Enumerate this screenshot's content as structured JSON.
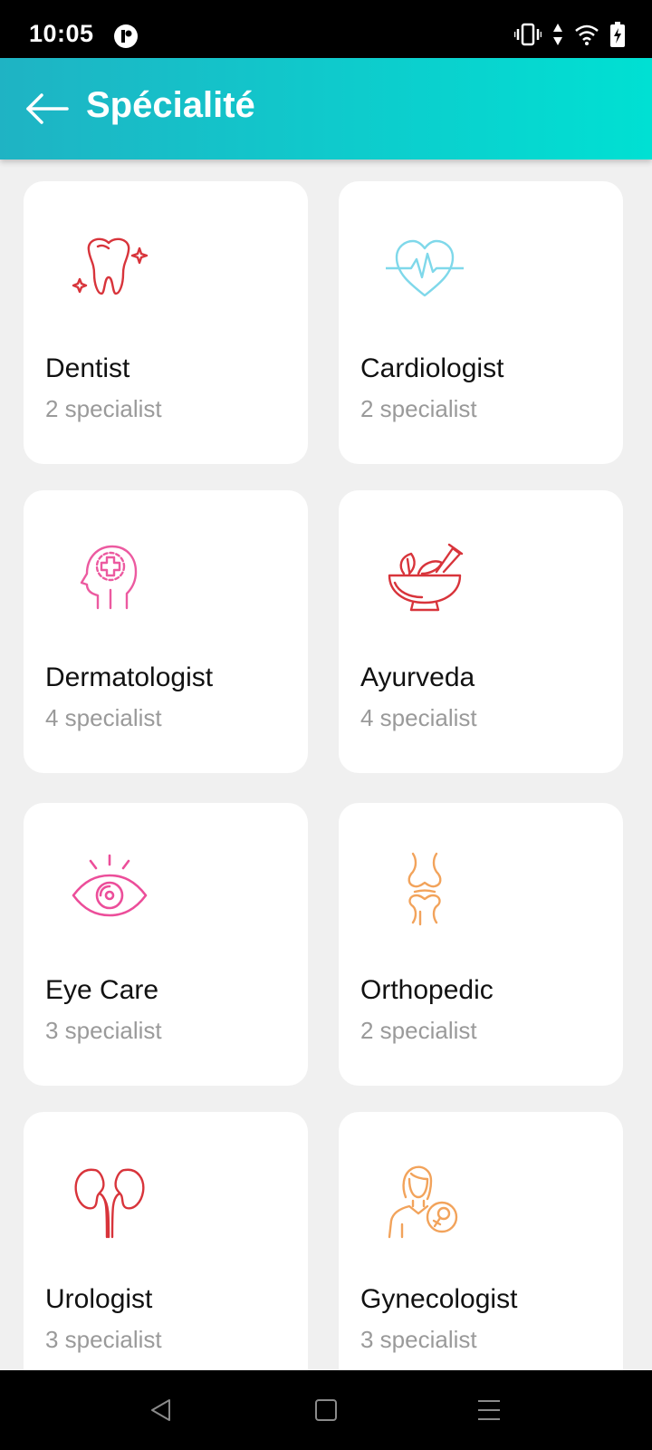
{
  "status_bar": {
    "time": "10:05",
    "icons": [
      "vibrate-icon",
      "data-arrows-icon",
      "wifi-icon",
      "battery-charging-icon"
    ]
  },
  "header": {
    "title": "Spécialité",
    "back_icon": "arrow-left-icon"
  },
  "specialties": [
    {
      "name": "Dentist",
      "count": "2 specialist",
      "icon": "tooth-icon",
      "color": "#d8343b"
    },
    {
      "name": "Cardiologist",
      "count": "2 specialist",
      "icon": "heartbeat-icon",
      "color": "#7fd8ea"
    },
    {
      "name": "Dermatologist",
      "count": "4 specialist",
      "icon": "head-cross-icon",
      "color": "#ec5aa0"
    },
    {
      "name": "Ayurveda",
      "count": "4 specialist",
      "icon": "mortar-pestle-icon",
      "color": "#d8343b"
    },
    {
      "name": "Eye Care",
      "count": "3 specialist",
      "icon": "eye-icon",
      "color": "#ec4e9a"
    },
    {
      "name": "Orthopedic",
      "count": "2 specialist",
      "icon": "knee-joint-icon",
      "color": "#f2a35b"
    },
    {
      "name": "Urologist",
      "count": "3 specialist",
      "icon": "kidneys-icon",
      "color": "#d8343b"
    },
    {
      "name": "Gynecologist",
      "count": "3 specialist",
      "icon": "female-doctor-icon",
      "color": "#f2a35b"
    }
  ],
  "nav_bar": {
    "buttons": [
      "back-triangle-icon",
      "home-square-icon",
      "menu-lines-icon"
    ]
  }
}
